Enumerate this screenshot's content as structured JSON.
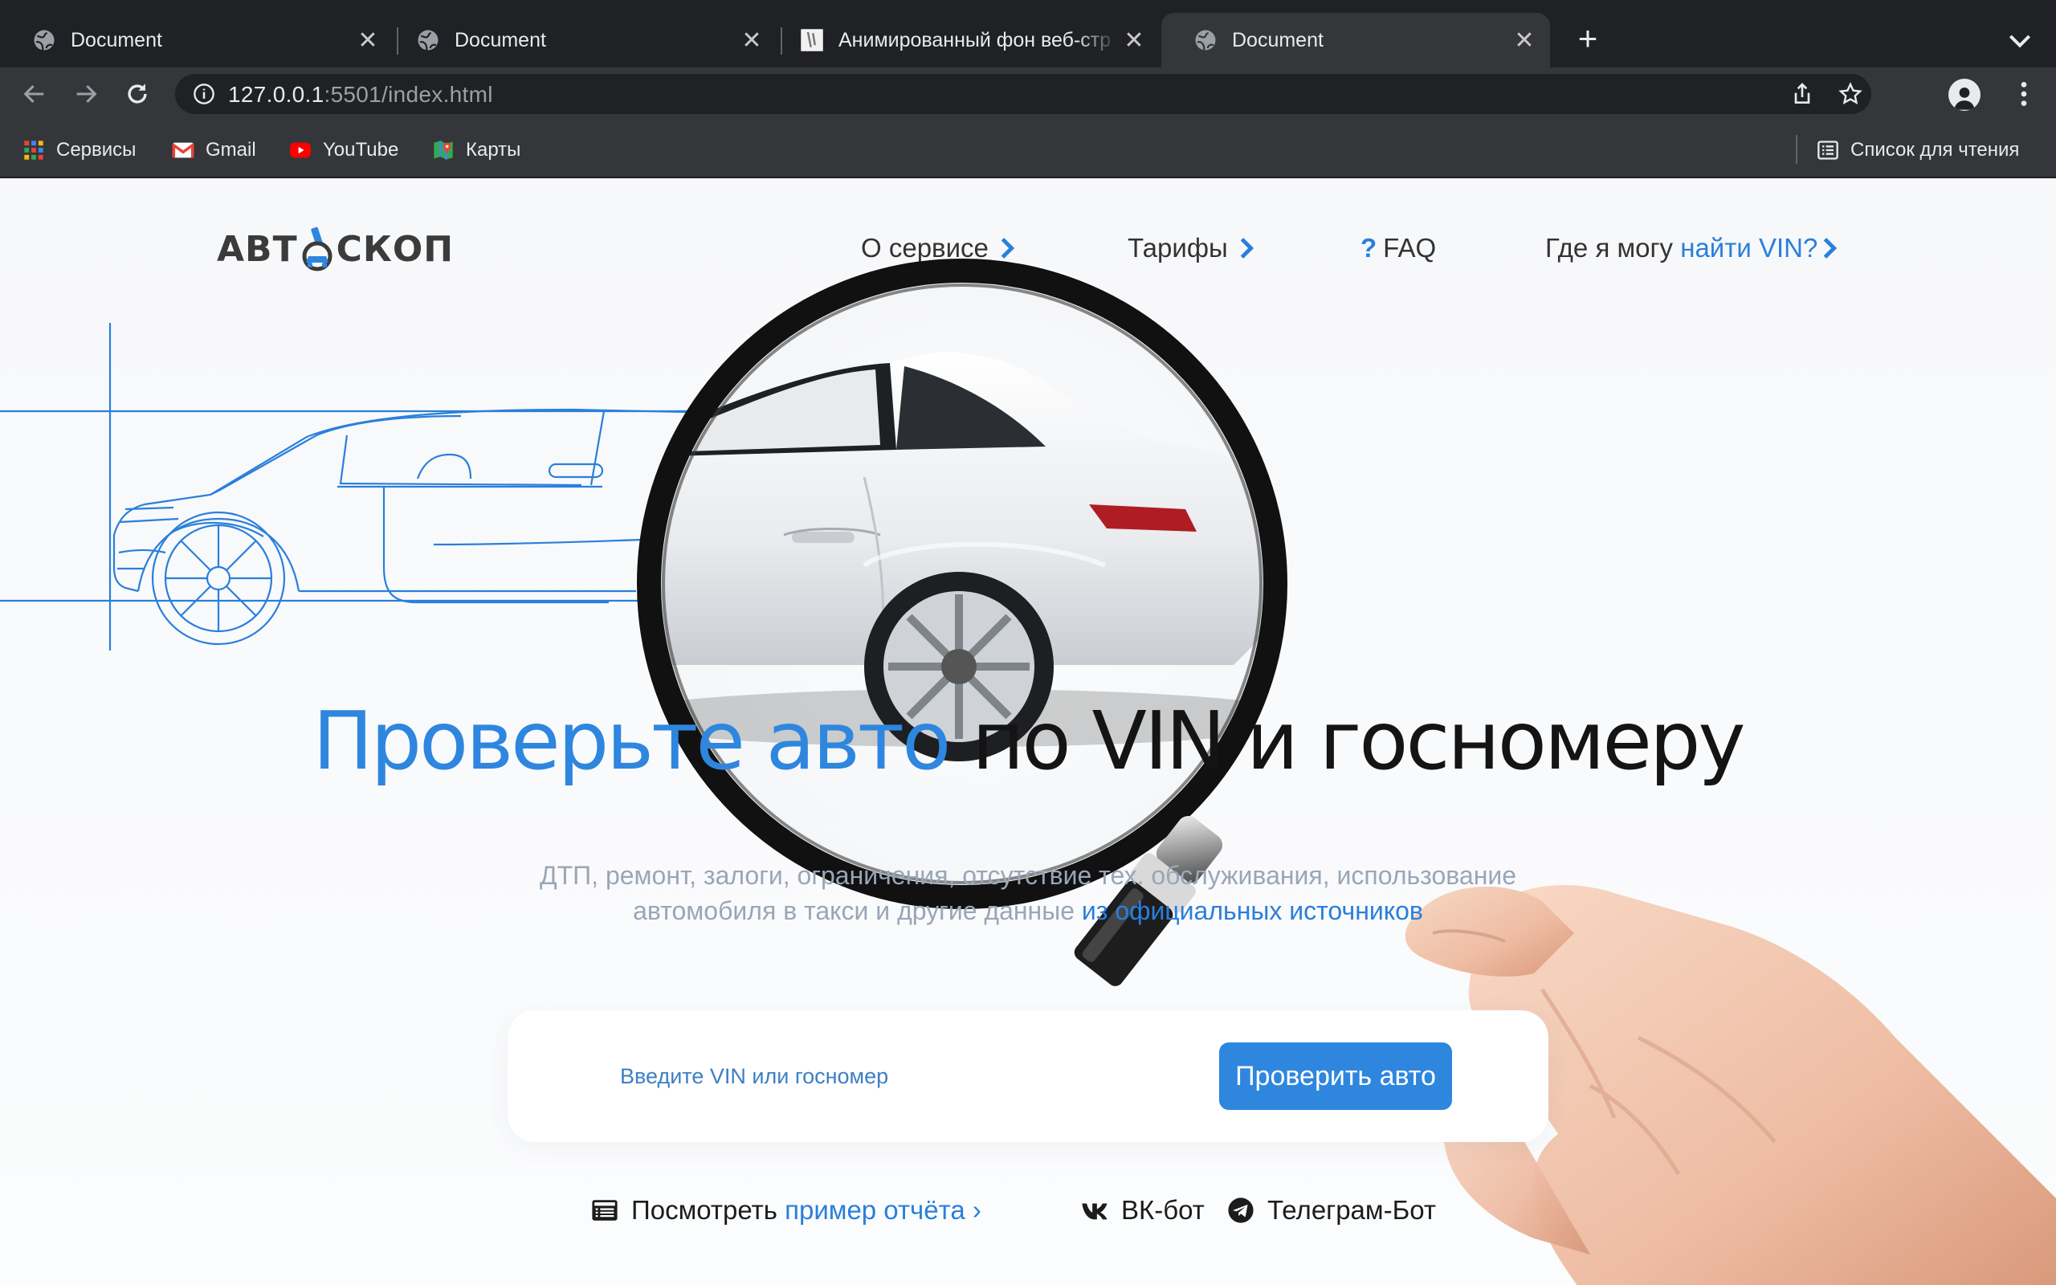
{
  "browser": {
    "tabs": [
      {
        "title": "Document",
        "favicon": "globe-icon",
        "active": false
      },
      {
        "title": "Document",
        "favicon": "globe-icon",
        "active": false
      },
      {
        "title": "Анимированный фон веб-стр",
        "favicon": "page-thumbnail-icon",
        "active": false
      },
      {
        "title": "Document",
        "favicon": "globe-icon",
        "active": true
      }
    ],
    "url": {
      "host": "127.0.0.1",
      "rest": ":5501/index.html"
    },
    "bookmarks": [
      {
        "label": "Сервисы",
        "icon": "apps-grid-icon"
      },
      {
        "label": "Gmail",
        "icon": "gmail-icon"
      },
      {
        "label": "YouTube",
        "icon": "youtube-icon"
      },
      {
        "label": "Карты",
        "icon": "maps-icon"
      }
    ],
    "reading_list": "Список для чтения",
    "colors": {
      "tabbar": "#202124",
      "toolbar": "#35363a",
      "text": "#e8eaed"
    }
  },
  "site": {
    "logo": {
      "left": "АВТ",
      "right": "СКОП"
    },
    "nav": {
      "about": "О сервисе",
      "tariffs": "Тарифы",
      "faq_mark": "?",
      "faq": "FAQ",
      "vin_prefix": "Где я могу",
      "vin_link": "найти VIN?"
    },
    "hero": {
      "title_highlight": "Проверьте авто",
      "title_rest": "по VIN и госномеру"
    },
    "subtitle": {
      "line1": "ДТП, ремонт, залоги, ограничения, отсутствие тех. обслуживания, использование",
      "line2_prefix": "автомобиля в такси и другие данные",
      "line2_link": "из официальных источников"
    },
    "search": {
      "placeholder": "Введите VIN или госномер",
      "button": "Проверить авто"
    },
    "report": {
      "prefix": "Посмотреть",
      "link": "пример отчёта",
      "arrow": "›"
    },
    "bots": {
      "vk": "ВК-бот",
      "telegram": "Телеграм-Бот"
    },
    "colors": {
      "accent": "#2e86de",
      "text": "#141414",
      "muted": "#9aa6b6"
    }
  }
}
